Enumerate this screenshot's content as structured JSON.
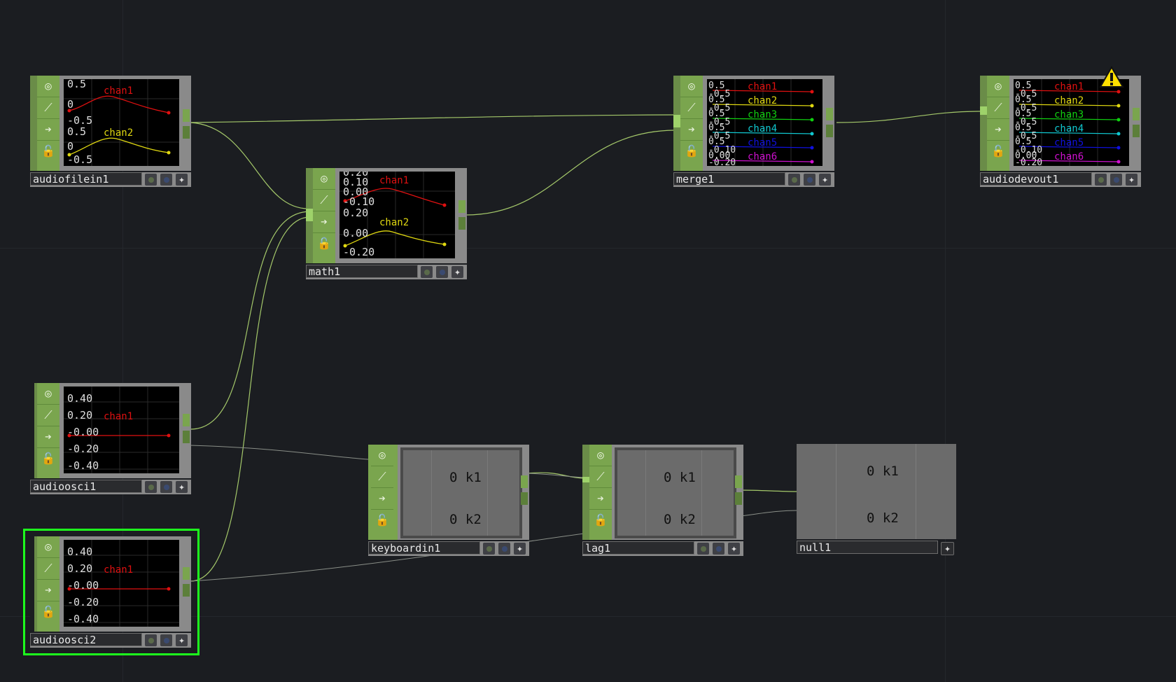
{
  "nodes": {
    "audiofilein1": {
      "name": "audiofilein1",
      "labels": [
        "0.5",
        "0",
        "-0.5",
        "0.5",
        "0",
        "-0.5"
      ],
      "channels": [
        "chan1",
        "chan2"
      ]
    },
    "math1": {
      "name": "math1",
      "labels": [
        "0.20",
        "0.10",
        "0.00",
        "-0.10",
        "0.20",
        "0.00",
        "-0.20"
      ],
      "channels": [
        "chan1",
        "chan2"
      ]
    },
    "merge1": {
      "name": "merge1",
      "labels": [
        "0.5",
        "-0.5",
        "0.5",
        "-0.5",
        "0.5",
        "-0.5",
        "0.5",
        "-0.5",
        "0.5",
        "-0.10",
        "0.00",
        "-0.20"
      ],
      "channels": [
        "chan1",
        "chan2",
        "chan3",
        "chan4",
        "chan5",
        "chan6"
      ]
    },
    "audiodevout1": {
      "name": "audiodevout1",
      "labels": [
        "0.5",
        "-0.5",
        "0.5",
        "-0.5",
        "0.5",
        "-0.5",
        "0.5",
        "-0.5",
        "0.5",
        "-0.10",
        "0.00",
        "-0.20"
      ],
      "channels": [
        "chan1",
        "chan2",
        "chan3",
        "chan4",
        "chan5",
        "chan6"
      ]
    },
    "audioosci1": {
      "name": "audioosci1",
      "labels": [
        "0.40",
        "0.20",
        "-0.00",
        "-0.20",
        "-0.40"
      ],
      "channels": [
        "chan1"
      ]
    },
    "audioosci2": {
      "name": "audioosci2",
      "labels": [
        "0.40",
        "0.20",
        "-0.00",
        "-0.20",
        "-0.40"
      ],
      "channels": [
        "chan1"
      ]
    },
    "keyboardin1": {
      "name": "keyboardin1",
      "rows": [
        {
          "value": "0",
          "key": "k1"
        },
        {
          "value": "0",
          "key": "k2"
        }
      ]
    },
    "lag1": {
      "name": "lag1",
      "rows": [
        {
          "value": "0",
          "key": "k1"
        },
        {
          "value": "0",
          "key": "k2"
        }
      ]
    },
    "null1": {
      "name": "null1",
      "rows": [
        {
          "value": "0",
          "key": "k1"
        },
        {
          "value": "0",
          "key": "k2"
        }
      ]
    }
  },
  "icons": [
    "viewer-toggle-icon",
    "graph-icon",
    "arrow-right-icon",
    "lock-icon"
  ],
  "colors": {
    "chan1": "#e01010",
    "chan2": "#e0d810",
    "chan3": "#10d010",
    "chan4": "#10c8d0",
    "chan5": "#1010e0",
    "chan6": "#d010d0",
    "selection": "#1dff1d",
    "chop_green": "#7aa54e",
    "background": "#1b1d21"
  }
}
